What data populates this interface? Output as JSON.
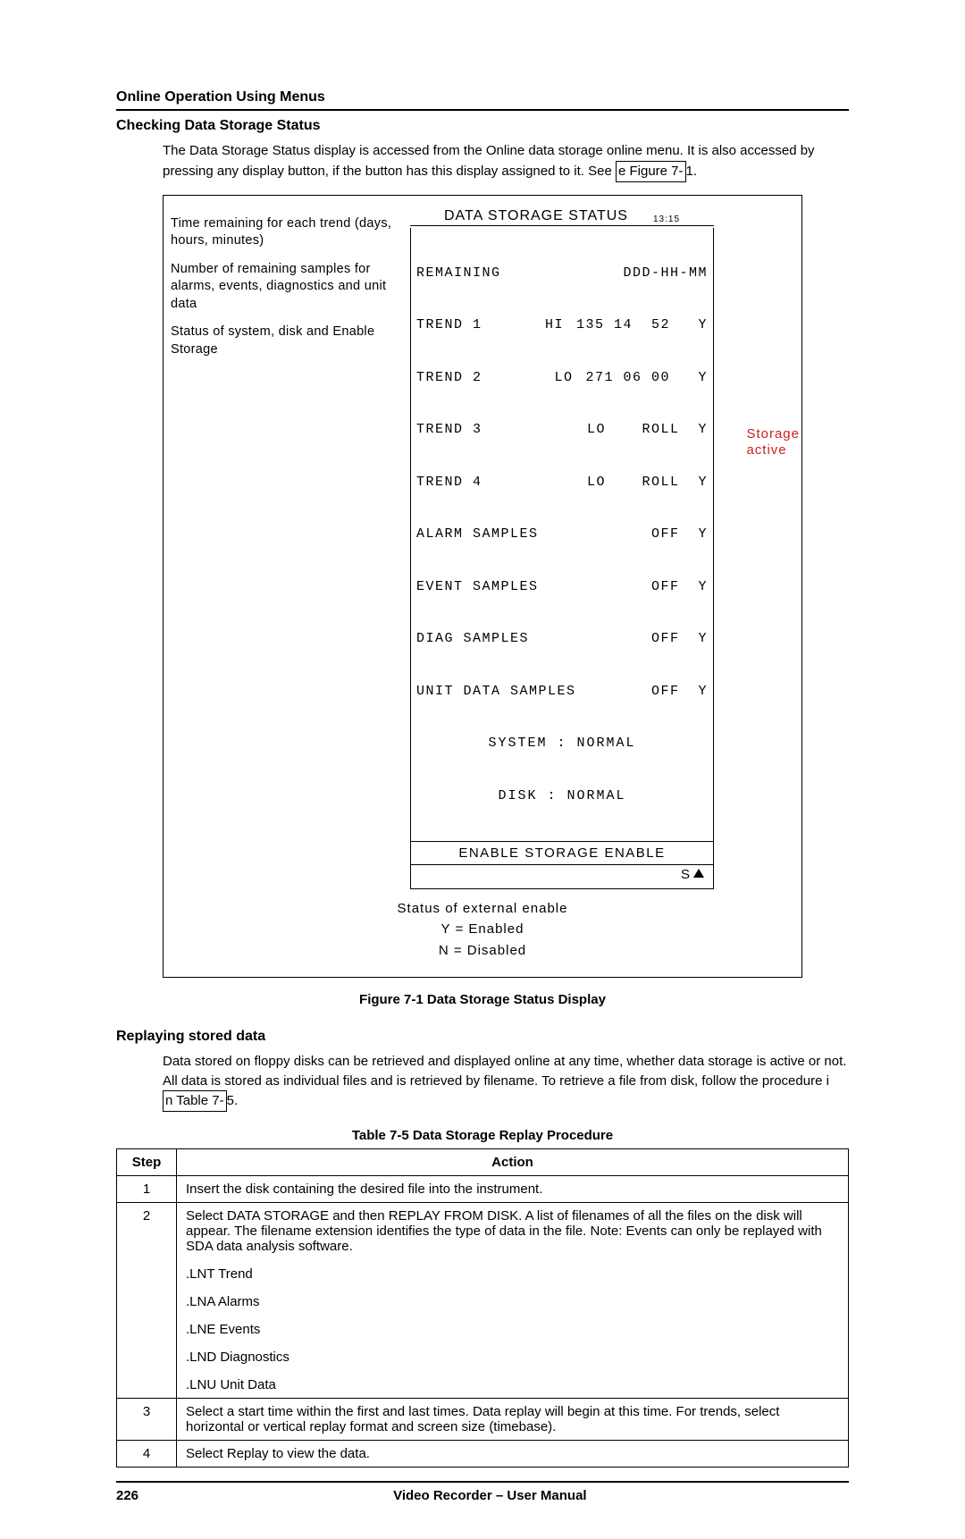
{
  "header": "Online Operation Using Menus",
  "section1": {
    "heading": "Checking Data Storage Status",
    "para": "The Data Storage Status display is accessed from the Online data storage online menu.  It is also accessed by pressing any display button, if the button has this display assigned to it.  See",
    "xref_part1": "e Figure 7-",
    "xref_suffix": "1."
  },
  "figure": {
    "left_label_1": "Time remaining for each trend (days, hours, minutes)",
    "left_label_2": "Number of remaining samples for alarms, events, diagnostics and unit data",
    "left_label_3": "Status of system, disk and Enable Storage",
    "title": "DATA STORAGE STATUS",
    "clock": "13:15",
    "header_row": {
      "l": "REMAINING",
      "r": "DDD-HH-MM"
    },
    "rows": [
      {
        "l": "TREND 1",
        "m": "HI",
        "r": "135 14  52   Y"
      },
      {
        "l": "TREND 2",
        "m": "LO",
        "r": "271 06 00   Y"
      },
      {
        "l": "TREND 3",
        "m": "LO",
        "r": "ROLL  Y"
      },
      {
        "l": "TREND 4",
        "m": "LO",
        "r": "ROLL  Y"
      },
      {
        "l": "ALARM SAMPLES",
        "m": "",
        "r": "OFF  Y"
      },
      {
        "l": "EVENT SAMPLES",
        "m": "",
        "r": "OFF  Y"
      },
      {
        "l": "DIAG SAMPLES",
        "m": "",
        "r": "OFF  Y"
      },
      {
        "l": "UNIT DATA SAMPLES",
        "m": "",
        "r": "OFF  Y"
      }
    ],
    "system_line": "SYSTEM : NORMAL",
    "disk_line": "DISK : NORMAL",
    "enable_row": "ENABLE  STORAGE  ENABLE",
    "s_indicator": "S",
    "storage_active_1": "Storage",
    "storage_active_2": "active",
    "below_1": "Status of external enable",
    "below_2": "Y = Enabled",
    "below_3": "N = Disabled",
    "caption": "Figure 7-1   Data Storage Status Display"
  },
  "section2": {
    "heading": "Replaying stored data",
    "para": "Data stored on floppy disks can be retrieved and displayed online at any time, whether data storage is active or not.  All data is stored as individual files and is retrieved by filename.  To retrieve a file from disk, follow the procedure i",
    "xref": "n Table 7-",
    "xref_suffix": "5."
  },
  "table": {
    "caption": "Table 7-5   Data Storage Replay Procedure",
    "col_step": "Step",
    "col_action": "Action",
    "rows": [
      {
        "step": "1",
        "action": "Insert the disk containing the desired file into the instrument."
      },
      {
        "step": "2",
        "action": "Select DATA STORAGE and then REPLAY FROM DISK. A list of filenames of all the files on the disk will appear.  The filename extension identifies the type of data in the file.  Note: Events can only be replayed with SDA data analysis software.",
        "filetypes": [
          ".LNT Trend",
          ".LNA Alarms",
          ".LNE Events",
          ".LND Diagnostics",
          ".LNU Unit Data"
        ]
      },
      {
        "step": "3",
        "action": "Select a start time within the first and last times. Data replay will begin at this time. For trends, select horizontal or vertical replay format and screen size (timebase)."
      },
      {
        "step": "4",
        "action": "Select Replay to view the data."
      }
    ]
  },
  "footer": {
    "page": "226",
    "doc": "Video Recorder – User Manual"
  }
}
